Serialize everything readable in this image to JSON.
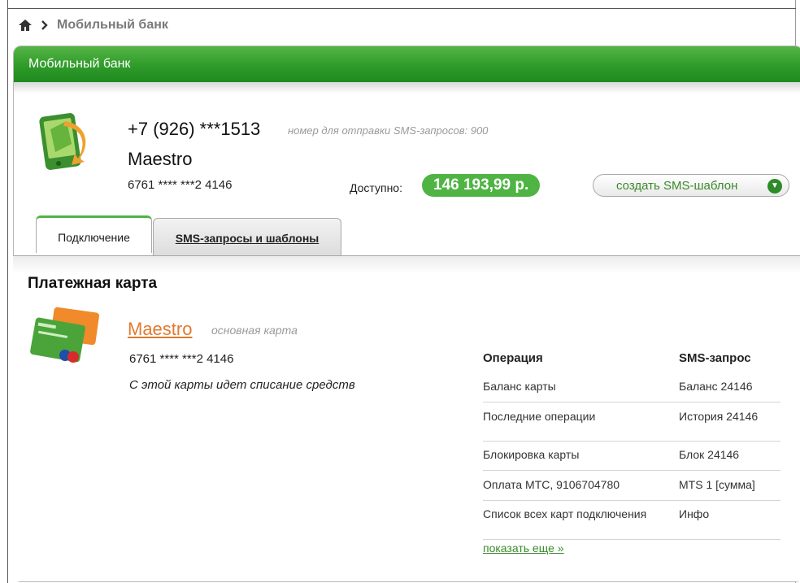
{
  "breadcrumb": {
    "icon": "home-icon",
    "separator": "›",
    "current": "Мобильный банк"
  },
  "panel": {
    "title": "Мобильный банк"
  },
  "account": {
    "phone": "+7 (926) ***1513",
    "sms_hint": "номер для отправки SMS-запросов: 900",
    "card_name": "Maestro",
    "card_number": "6761 **** ***2 4146",
    "available_label": "Доступно:",
    "available_amount": "146 193,99 р.",
    "template_button": "создать SMS-шаблон"
  },
  "tabs": [
    {
      "label": "Подключение",
      "active": true
    },
    {
      "label": "SMS-запросы и шаблоны",
      "active": false
    }
  ],
  "payment_card": {
    "section_title": "Платежная карта",
    "name": "Maestro",
    "type": "основная карта",
    "number": "6761 **** ***2 4146",
    "note": "С этой карты идет списание средств"
  },
  "sms_table": {
    "headers": [
      "Операция",
      "SMS-запрос"
    ],
    "rows": [
      {
        "operation": "Баланс карты",
        "sms": "Баланс 24146"
      },
      {
        "operation": "Последние операции",
        "sms": "История 24146"
      },
      {
        "operation": "Блокировка карты",
        "sms": "Блок 24146"
      },
      {
        "operation": "Оплата МТС, 9106704780",
        "sms": "MTS 1 [сумма]"
      },
      {
        "operation": "Список всех карт подключения",
        "sms": "Инфо"
      }
    ]
  },
  "show_more": "показать еще »",
  "colors": {
    "brand_green": "#2f9b2a",
    "badge_green": "#4fb444",
    "link_orange": "#e07a2e"
  }
}
